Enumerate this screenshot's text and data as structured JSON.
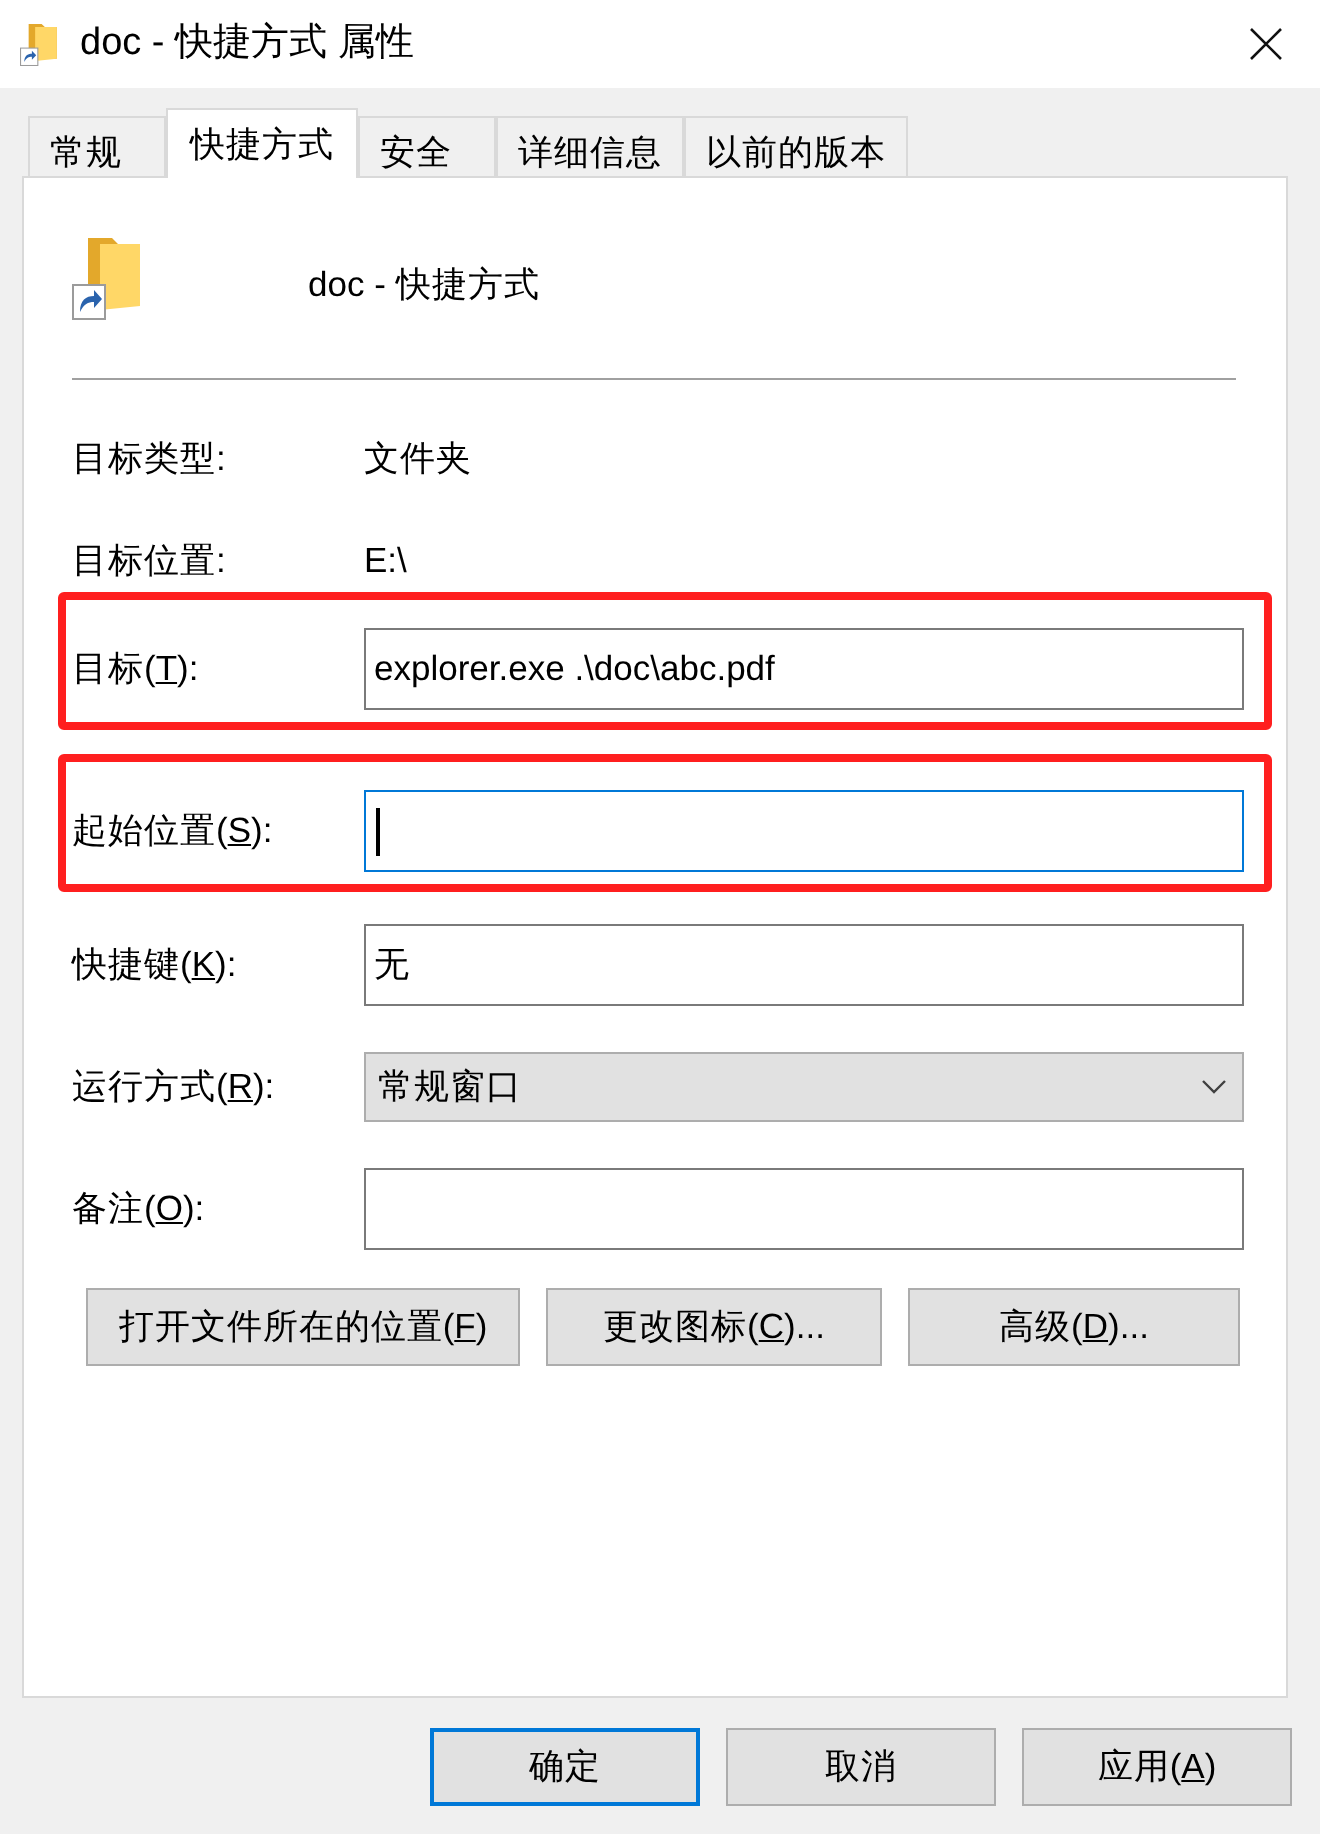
{
  "window": {
    "title": "doc - 快捷方式 属性"
  },
  "tabs": [
    {
      "label": "常规",
      "selected": false
    },
    {
      "label": "快捷方式",
      "selected": true
    },
    {
      "label": "安全",
      "selected": false
    },
    {
      "label": "详细信息",
      "selected": false
    },
    {
      "label": "以前的版本",
      "selected": false
    }
  ],
  "header": {
    "name": "doc - 快捷方式"
  },
  "info_rows": [
    {
      "label": "目标类型:",
      "value": "文件夹"
    },
    {
      "label": "目标位置:",
      "value": "E:\\"
    }
  ],
  "fields": [
    {
      "kind": "input",
      "label": "目标(",
      "access_key": "T",
      "label_rest": "):",
      "value": "explorer.exe .\\doc\\abc.pdf",
      "focused": false,
      "highlighted": true
    },
    {
      "kind": "input",
      "label": "起始位置(",
      "access_key": "S",
      "label_rest": "):",
      "focused": true,
      "highlighted": true
    },
    {
      "kind": "input",
      "label": "快捷键(",
      "access_key": "K",
      "label_rest": "):",
      "value": "无",
      "focused": false,
      "highlighted": false
    },
    {
      "kind": "select",
      "label": "运行方式(",
      "access_key": "R",
      "label_rest": "):",
      "value": "常规窗口",
      "focused": false,
      "highlighted": false
    },
    {
      "kind": "input",
      "label": "备注(",
      "access_key": "O",
      "label_rest": "):",
      "focused": false,
      "highlighted": false
    }
  ],
  "actions": [
    {
      "label": "打开文件所在的位置(",
      "access_key": "F",
      "label_rest": ")"
    },
    {
      "label": "更改图标(",
      "access_key": "C",
      "label_rest": ")..."
    },
    {
      "label": "高级(",
      "access_key": "D",
      "label_rest": ")..."
    }
  ],
  "footer_buttons": [
    {
      "label": "确定",
      "default": true
    },
    {
      "label": "取消",
      "default": false
    },
    {
      "label": "应用(",
      "access_key": "A",
      "label_rest": ")",
      "default": false
    }
  ]
}
